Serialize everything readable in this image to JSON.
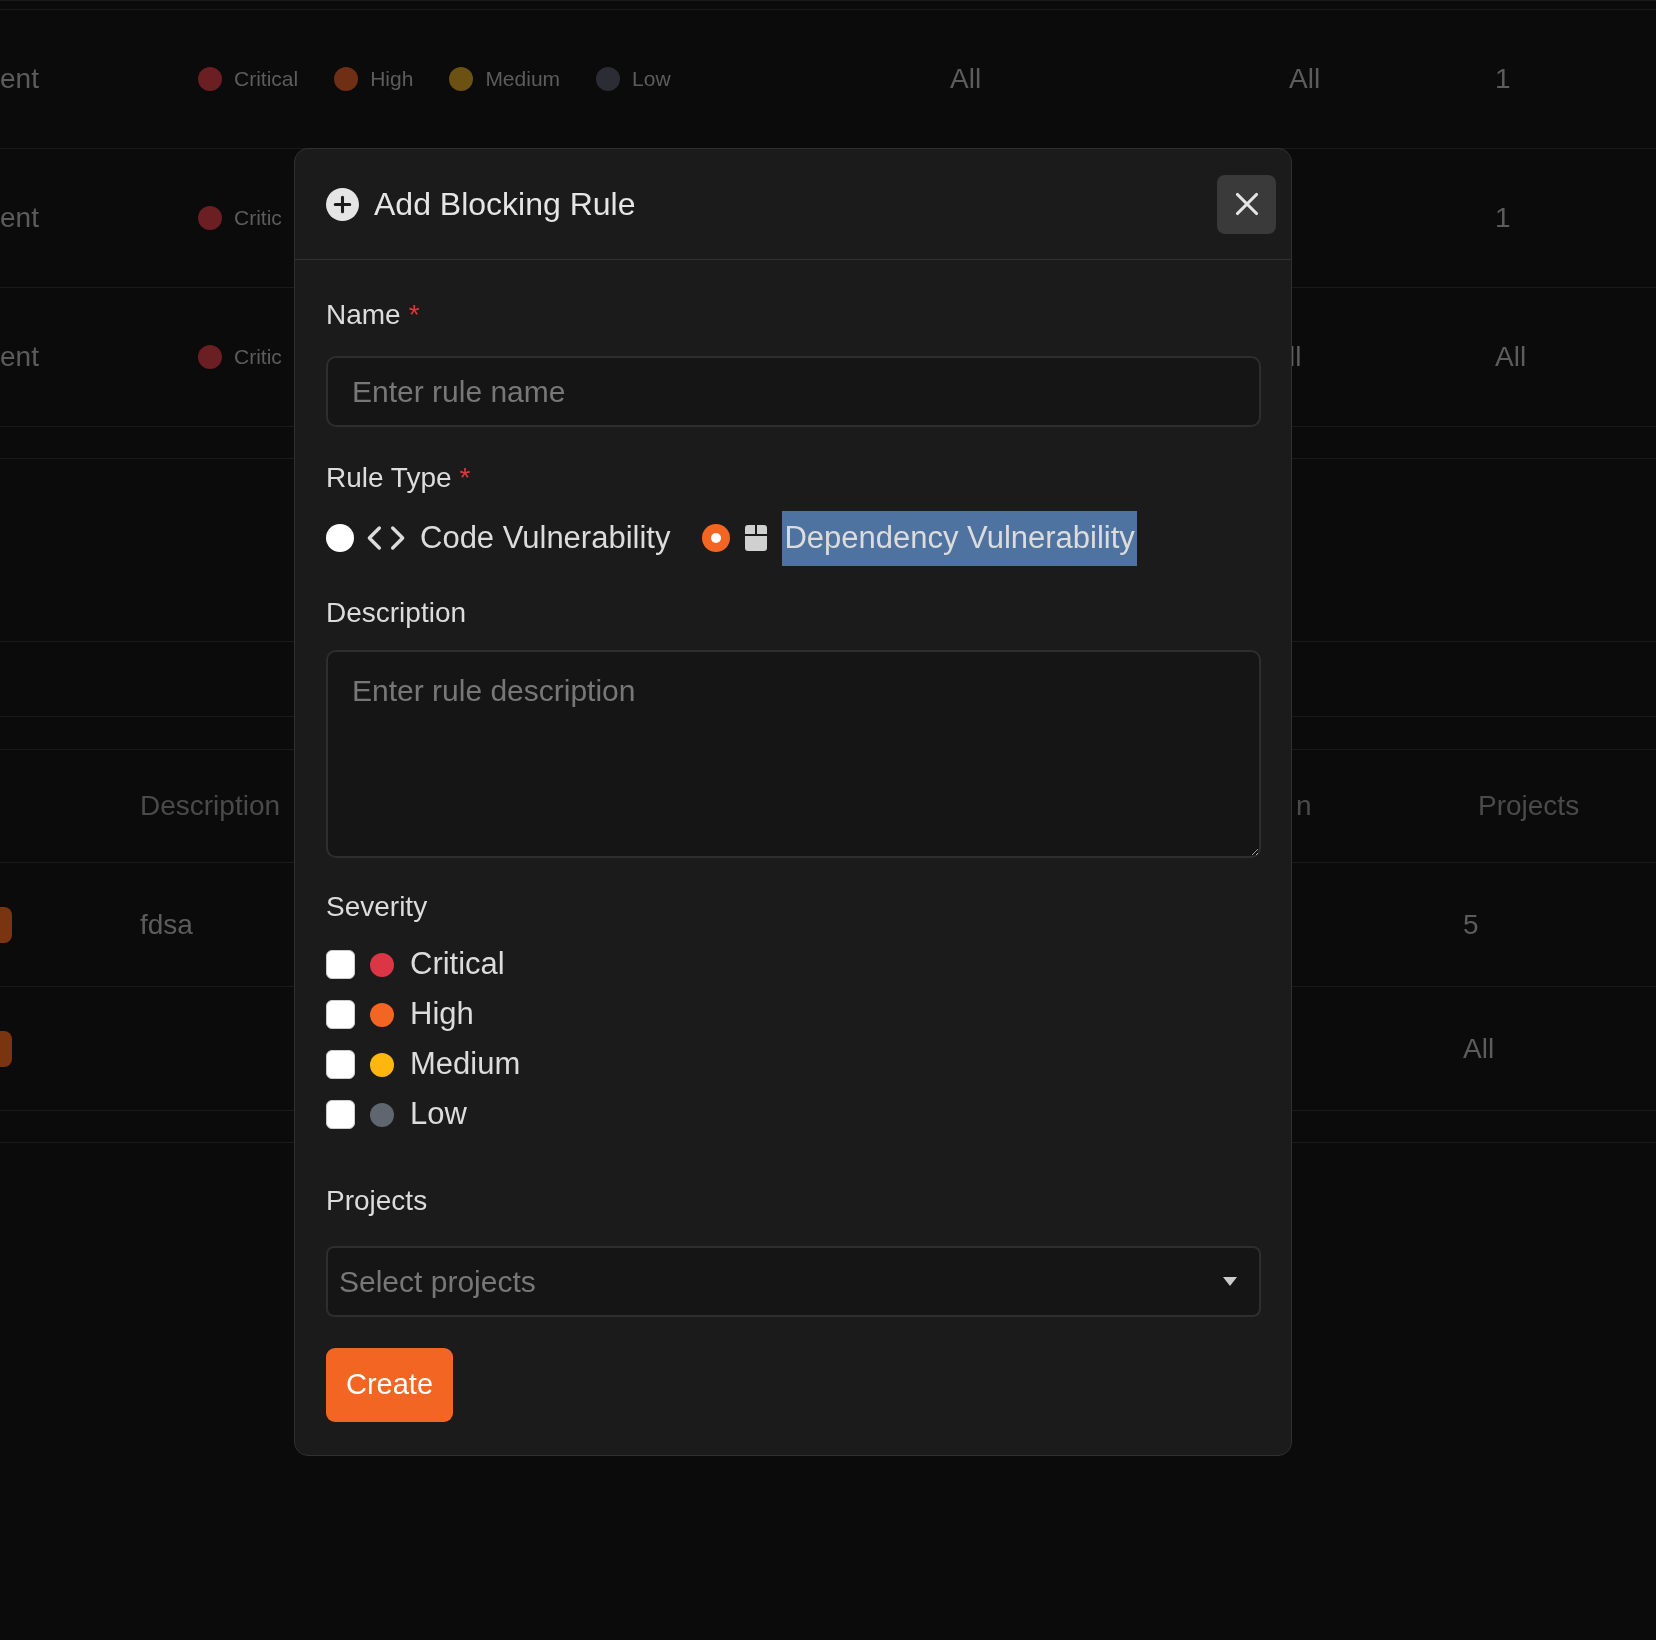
{
  "background_table_top": {
    "rows": [
      {
        "column_1": "ent",
        "severities": [
          {
            "label": "Critical",
            "color": "#6b1f22"
          },
          {
            "label": "High",
            "color": "#6e2f14"
          },
          {
            "label": "Medium",
            "color": "#6b5212"
          },
          {
            "label": "Low",
            "color": "#2a2d33"
          }
        ],
        "column_3": "All",
        "column_4": "All",
        "column_5": "1"
      },
      {
        "column_1": "ent",
        "severities": [
          {
            "label": "Critic",
            "color": "#6b1f22"
          }
        ],
        "column_5": "1"
      },
      {
        "column_1": "ent",
        "severities": [
          {
            "label": "Critic",
            "color": "#6b1f22"
          }
        ],
        "column_4": "ll",
        "column_5": "All"
      }
    ]
  },
  "background_table_bottom": {
    "columns": [
      "Description",
      "n",
      "Projects"
    ],
    "rows": [
      {
        "badge": true,
        "description": "fdsa",
        "projects": "5"
      },
      {
        "badge": true,
        "projects": "All"
      }
    ]
  },
  "dialog": {
    "title": "Add Blocking Rule",
    "name_field": {
      "label": "Name",
      "required_mark": "*",
      "placeholder": "Enter rule name"
    },
    "rule_type": {
      "label": "Rule Type",
      "required_mark": "*",
      "options": [
        {
          "label": "Code Vulnerability",
          "kind": "code",
          "selected": false,
          "highlighted": false
        },
        {
          "label": "Dependency Vulnerability",
          "kind": "package",
          "selected": true,
          "highlighted": true
        }
      ]
    },
    "description_field": {
      "label": "Description",
      "placeholder": "Enter rule description"
    },
    "severity": {
      "label": "Severity",
      "options": [
        {
          "label": "Critical",
          "color": "#dc3545",
          "checked": false
        },
        {
          "label": "High",
          "color": "#f26522",
          "checked": false
        },
        {
          "label": "Medium",
          "color": "#ffb70f",
          "checked": false
        },
        {
          "label": "Low",
          "color": "#5f6670",
          "checked": false
        }
      ]
    },
    "projects_field": {
      "label": "Projects",
      "placeholder": "Select projects"
    },
    "submit": "Create"
  }
}
